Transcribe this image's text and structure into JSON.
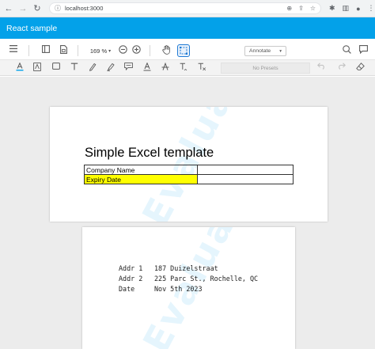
{
  "browser": {
    "url": "localhost:3000"
  },
  "app": {
    "title": "React sample"
  },
  "toolbar": {
    "zoom": "169 %",
    "mode": "Annotate",
    "presets_placeholder": "No Presets"
  },
  "document": {
    "title": "Simple Excel template",
    "table": [
      [
        "Company Name",
        ""
      ],
      [
        "Expiry Date",
        ""
      ]
    ],
    "address": [
      {
        "label": "Addr 1",
        "value": "187 Duizelstraat"
      },
      {
        "label": "Addr 2",
        "value": "225 Parc St., Rochelle, QC"
      },
      {
        "label": "Date",
        "value": "Nov 5th 2023"
      }
    ],
    "highlight_color": "#ffff00"
  },
  "colors": {
    "header_bg": "#03a1e9",
    "active_tool_border": "#1f7ad4"
  }
}
